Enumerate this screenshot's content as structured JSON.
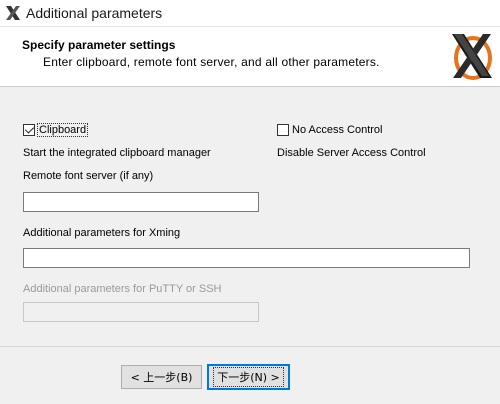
{
  "window": {
    "title": "Additional parameters"
  },
  "header": {
    "title": "Specify parameter settings",
    "subtitle": "Enter clipboard, remote font server, and all other parameters."
  },
  "clipboard": {
    "label": "Clipboard",
    "checked": true,
    "description": "Start the integrated clipboard manager"
  },
  "no_access_control": {
    "label": "No Access Control",
    "checked": false,
    "description": "Disable Server Access Control"
  },
  "remote_font_server": {
    "label": "Remote font server (if any)",
    "value": ""
  },
  "xming_params": {
    "label": "Additional parameters for Xming",
    "value": ""
  },
  "putty_params": {
    "label": "Additional parameters for PuTTY or SSH",
    "value": "",
    "disabled": true
  },
  "buttons": {
    "back": "< 上一步(B)",
    "next": "下一步(N) >"
  },
  "icons": {
    "app": "xming-x-icon",
    "logo": "xming-logo-icon"
  },
  "colors": {
    "focus_border": "#0078d7",
    "logo_orange": "#e8731a"
  }
}
